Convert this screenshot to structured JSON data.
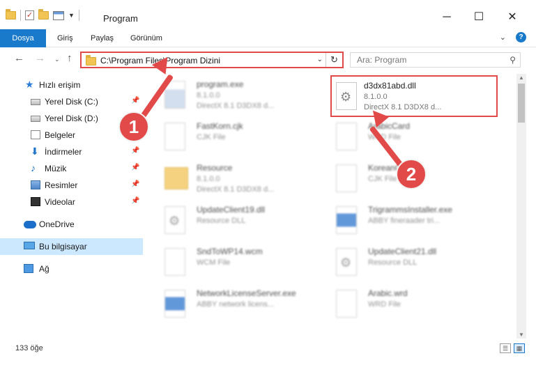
{
  "window": {
    "title": "Program",
    "minimize": "─",
    "maximize": "☐",
    "close": "✕"
  },
  "ribbon": {
    "tabs": [
      "Dosya",
      "Giriş",
      "Paylaş",
      "Görünüm"
    ],
    "help": "?"
  },
  "address": {
    "path": "C:\\Program Files\\Program Dizini",
    "search_placeholder": "Ara: Program"
  },
  "sidebar": {
    "items": [
      {
        "label": "Hızlı erişim",
        "icon": "star-icon"
      },
      {
        "label": "Yerel Disk (C:)",
        "icon": "drive-icon"
      },
      {
        "label": "Yerel Disk (D:)",
        "icon": "drive-icon"
      },
      {
        "label": "Belgeler",
        "icon": "document-icon"
      },
      {
        "label": "İndirmeler",
        "icon": "download-icon"
      },
      {
        "label": "Müzik",
        "icon": "music-icon"
      },
      {
        "label": "Resimler",
        "icon": "pictures-icon"
      },
      {
        "label": "Videolar",
        "icon": "video-icon"
      },
      {
        "label": "OneDrive",
        "icon": "cloud-icon"
      },
      {
        "label": "Bu bilgisayar",
        "icon": "computer-icon"
      },
      {
        "label": "Ağ",
        "icon": "network-icon"
      }
    ]
  },
  "files": [
    {
      "name": "program.exe",
      "line1": "8.1.0.0",
      "line2": "DirectX 8.1 D3DX8 d..."
    },
    {
      "name": "d3dx81abd.dll",
      "line1": "8.1.0.0",
      "line2": "DirectX 8.1 D3DX8 d..."
    },
    {
      "name": "FastKorn.cjk",
      "line1": "CJK File",
      "line2": ""
    },
    {
      "name": "ArabicCard",
      "line1": "WRD File",
      "line2": ""
    },
    {
      "name": "Resource",
      "line1": "8.1.0.0",
      "line2": "DirectX 8.1 D3DX8 d..."
    },
    {
      "name": "KoreanCard",
      "line1": "CJK File",
      "line2": ""
    },
    {
      "name": "UpdateClient19.dll",
      "line1": "Resource DLL",
      "line2": ""
    },
    {
      "name": "TrigrammsInstaller.exe",
      "line1": "ABBY fineraader tri...",
      "line2": ""
    },
    {
      "name": "SndToWP14.wcm",
      "line1": "WCM File",
      "line2": ""
    },
    {
      "name": "UpdateClient21.dll",
      "line1": "Resource DLL",
      "line2": ""
    },
    {
      "name": "NetworkLicenseServer.exe",
      "line1": "ABBY network licens...",
      "line2": ""
    },
    {
      "name": "Arabic.wrd",
      "line1": "WRD File",
      "line2": ""
    }
  ],
  "status": {
    "count": "133 öğe"
  },
  "annotations": {
    "callout1": "1",
    "callout2": "2",
    "color": "#e24a4a"
  },
  "colors": {
    "accent": "#1979ca",
    "selected": "#cce8ff"
  }
}
